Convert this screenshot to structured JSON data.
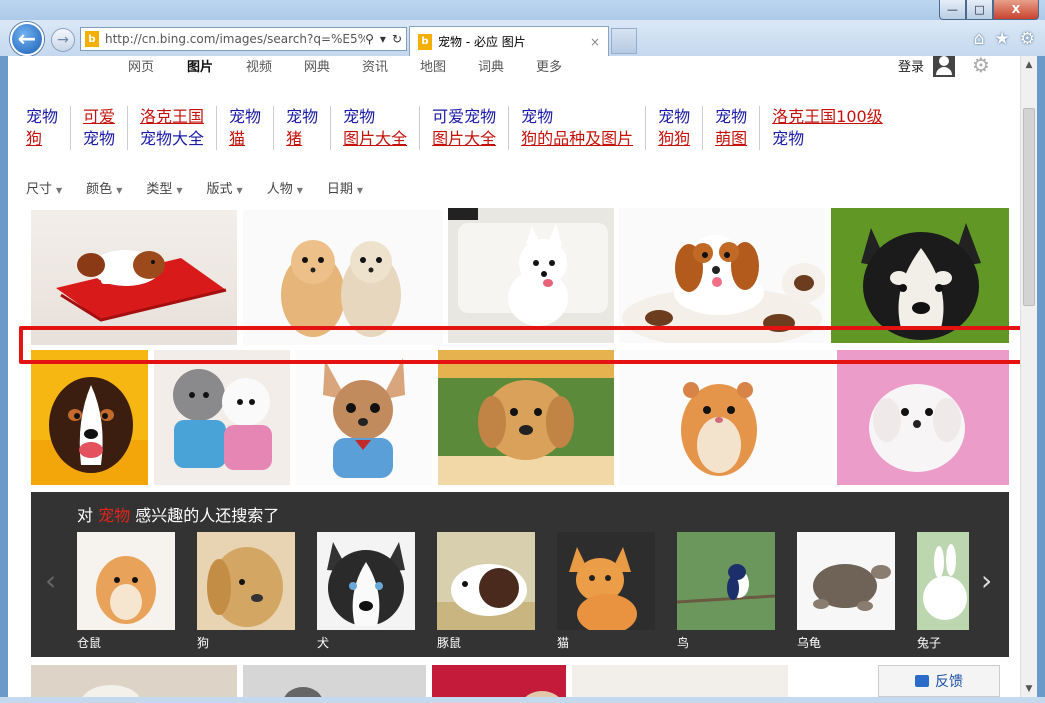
{
  "browser": {
    "url": "http://cn.bing.com/images/search?q=%E5%",
    "tab_title": "宠物 - 必应 图片",
    "tab_close": "×",
    "bing_glyph": "b",
    "window_buttons": {
      "minimize": "—",
      "maximize": "□",
      "close": "X"
    },
    "back": "←",
    "forward": "→",
    "addr_search": "⚲",
    "addr_dropdown": "▾",
    "addr_refresh": "↻",
    "home": "⌂",
    "favorites": "★",
    "tools": "⚙"
  },
  "topnav": {
    "items": [
      "网页",
      "图片",
      "视频",
      "网典",
      "资讯",
      "地图",
      "词典",
      "更多"
    ],
    "active": "图片",
    "login": "登录",
    "settings_glyph": "⚙"
  },
  "related_searches": [
    {
      "line1": "宠物",
      "line2": "狗",
      "c1": "blue",
      "c2": "red"
    },
    {
      "line1": "可爱",
      "line2": "宠物",
      "c1": "red",
      "c2": "blue"
    },
    {
      "line1": "洛克王国",
      "line2": "宠物大全",
      "c1": "red",
      "c2": "blue"
    },
    {
      "line1": "宠物",
      "line2": "猫",
      "c1": "blue",
      "c2": "red"
    },
    {
      "line1": "宠物",
      "line2": "猪",
      "c1": "blue",
      "c2": "red"
    },
    {
      "line1": "宠物",
      "line2": "图片大全",
      "c1": "blue",
      "c2": "red"
    },
    {
      "line1": "可爱宠物",
      "line2": "图片大全",
      "c1": "blue",
      "c2": "red"
    },
    {
      "line1": "宠物",
      "line2": "狗的品种及图片",
      "c1": "blue",
      "c2": "red"
    },
    {
      "line1": "宠物",
      "line2": "狗狗",
      "c1": "blue",
      "c2": "red"
    },
    {
      "line1": "宠物",
      "line2": "萌图",
      "c1": "blue",
      "c2": "red"
    },
    {
      "line1": "洛克王国100级",
      "line2": "宠物",
      "c1": "red",
      "c2": "blue"
    }
  ],
  "filters": [
    "尺寸",
    "颜色",
    "类型",
    "版式",
    "人物",
    "日期"
  ],
  "filter_caret": "▼",
  "panel": {
    "title_prefix": "对 ",
    "keyword": "宠物",
    "title_suffix": " 感兴趣的人还搜索了",
    "arrow_left": "‹",
    "arrow_right": "›",
    "items": [
      "仓鼠",
      "狗",
      "犬",
      "豚鼠",
      "猫",
      "鸟",
      "乌龟",
      "兔子"
    ]
  },
  "feedback": "反馈",
  "colors": {
    "highlight": "#e51212",
    "link_blue": "#1a1aa6",
    "link_red": "#c4120b",
    "panel_bg": "#333333"
  }
}
